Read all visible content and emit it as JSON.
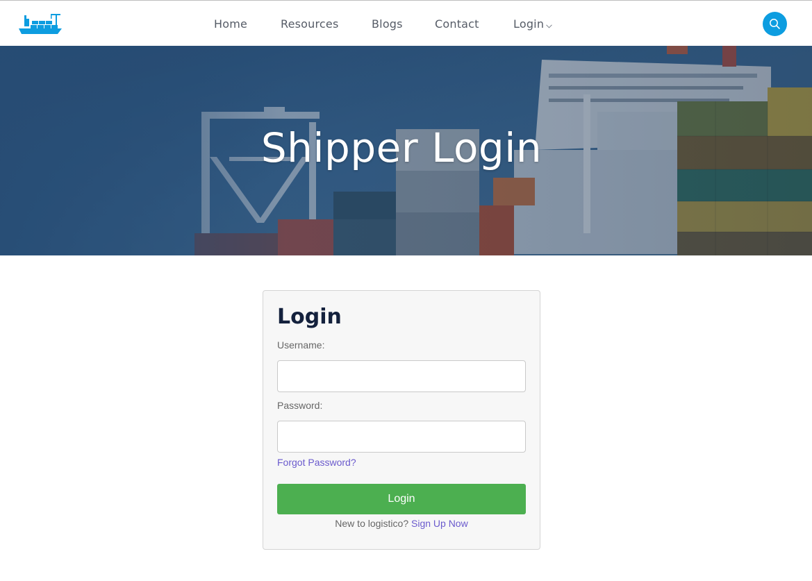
{
  "nav": {
    "logo_icon": "ship-logo-icon",
    "items": [
      {
        "label": "Home"
      },
      {
        "label": "Resources"
      },
      {
        "label": "Blogs"
      },
      {
        "label": "Contact"
      },
      {
        "label": "Login"
      }
    ],
    "search_icon": "search-icon",
    "accent_color": "#0d9de0"
  },
  "hero": {
    "title": "Shipper Login"
  },
  "login_form": {
    "title": "Login",
    "username_label": "Username:",
    "username_value": "",
    "password_label": "Password:",
    "password_value": "",
    "forgot_link": "Forgot Password?",
    "submit_label": "Login",
    "signup_prompt": "New to logistico?",
    "signup_link": "Sign Up Now",
    "button_color": "#4caf50",
    "link_color": "#6a5acd"
  }
}
